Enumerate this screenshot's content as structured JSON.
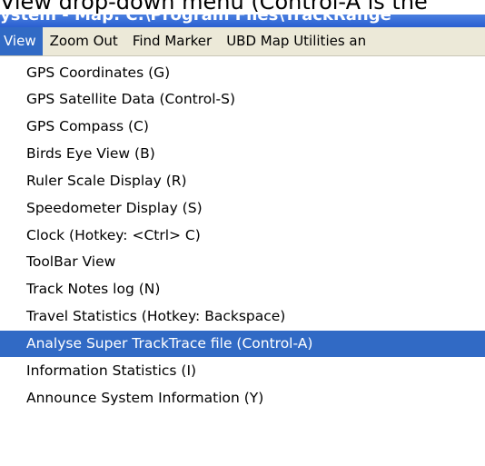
{
  "caption": "View drop-down menu (Control-A is the",
  "window_title": "ystem - Map: C:\\Program Files\\TrackRange",
  "menubar": {
    "items": [
      {
        "label": "View",
        "active": true
      },
      {
        "label": "Zoom Out"
      },
      {
        "label": "Find Marker"
      },
      {
        "label": "UBD Map Utilities an"
      }
    ]
  },
  "menu": {
    "items": [
      {
        "label": "GPS Coordinates (G)"
      },
      {
        "label": "GPS Satellite Data (Control-S)"
      },
      {
        "label": "GPS Compass (C)"
      },
      {
        "label": "Birds Eye View (B)"
      },
      {
        "label": "Ruler Scale Display (R)"
      },
      {
        "label": "Speedometer Display (S)"
      },
      {
        "label": "Clock (Hotkey: <Ctrl> C)"
      },
      {
        "label": "ToolBar View"
      },
      {
        "label": "Track Notes log (N)"
      },
      {
        "label": "Travel Statistics (Hotkey: Backspace)"
      },
      {
        "label": "Analyse Super TrackTrace file (Control-A)",
        "selected": true
      },
      {
        "label": "Information Statistics (I)"
      },
      {
        "label": "Announce System Information (Y)"
      }
    ]
  },
  "colors": {
    "highlight": "#316ac5",
    "menubar_bg": "#ece9d8",
    "titlebar": "#2a5fd0"
  }
}
